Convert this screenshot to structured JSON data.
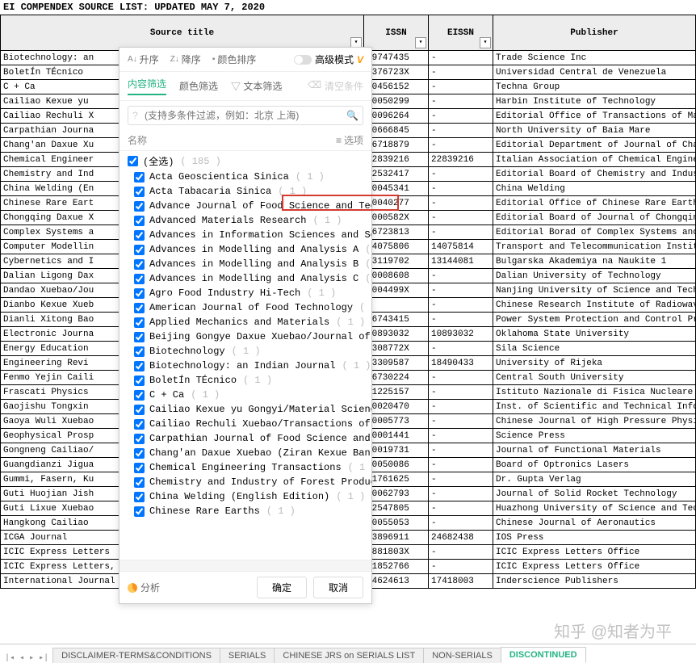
{
  "title": "EI COMPENDEX SOURCE LIST: UPDATED MAY 7, 2020",
  "columns": {
    "source_title": "Source title",
    "issn": "ISSN",
    "eissn": "EISSN",
    "publisher": "Publisher"
  },
  "rows": [
    {
      "title": "Biotechnology: an",
      "issn": "09747435",
      "eissn": "-",
      "pub": "Trade Science Inc"
    },
    {
      "title": "BoletÍn TÉcnico",
      "issn": "0376723X",
      "eissn": "-",
      "pub": "Universidad Central de Venezuela"
    },
    {
      "title": "C + Ca",
      "issn": "00456152",
      "eissn": "-",
      "pub": "Techna Group"
    },
    {
      "title": "Cailiao Kexue yu",
      "issn": "10050299",
      "eissn": "-",
      "pub": "Harbin Institute of Technology"
    },
    {
      "title": "Cailiao Rechuli X",
      "issn": "10096264",
      "eissn": "-",
      "pub": "Editorial Office of Transactions of Materi"
    },
    {
      "title": "Carpathian Journa",
      "issn": "20666845",
      "eissn": "-",
      "pub": "North University of Baia Mare"
    },
    {
      "title": "Chang'an Daxue Xu",
      "issn": "16718879",
      "eissn": "-",
      "pub": "Editorial Department of Journal of Chang'a"
    },
    {
      "title": "Chemical Engineer",
      "issn": "",
      "eissn": "22839216",
      "pub": "Italian Association of Chemical Engineerin"
    },
    {
      "title": "Chemistry and Ind",
      "issn": "02532417",
      "eissn": "-",
      "pub": "Editorial Board of Chemistry and Industry"
    },
    {
      "title": "China Welding (En",
      "issn": "10045341",
      "eissn": "-",
      "pub": "China Welding"
    },
    {
      "title": "Chinese Rare Eart",
      "issn": "10040277",
      "eissn": "-",
      "pub": "Editorial Office of Chinese Rare Earths"
    },
    {
      "title": "Chongqing Daxue X",
      "issn": "1000582X",
      "eissn": "-",
      "pub": "Editorial Board of Journal of Chongqing Un"
    },
    {
      "title": "Complex Systems a",
      "issn": "16723813",
      "eissn": "-",
      "pub": "Editorial Borad of Complex Systems and Com"
    },
    {
      "title": "Computer Modellin",
      "issn": "14075806",
      "eissn": "14075814",
      "pub": "Transport and Telecommunication Institute"
    },
    {
      "title": "Cybernetics and I",
      "issn": "13119702",
      "eissn": "13144081",
      "pub": "Bulgarska Akademiya na Naukite 1"
    },
    {
      "title": "Dalian Ligong Dax",
      "issn": "10008608",
      "eissn": "-",
      "pub": "Dalian University of Technology"
    },
    {
      "title": "Dandao Xuebao/Jou",
      "issn": "1004499X",
      "eissn": "-",
      "pub": "Nanjing University of Science and Technolo"
    },
    {
      "title": "Dianbo Kexue Xueb",
      "issn": "",
      "eissn": "-",
      "pub": "Chinese Research Institute of Radiowave Pr"
    },
    {
      "title": "Dianli Xitong Bao",
      "issn": "16743415",
      "eissn": "-",
      "pub": "Power System Protection and Control Press"
    },
    {
      "title": "Electronic Journa",
      "issn": "",
      "eissn": "10893032",
      "pub": "Oklahoma State University"
    },
    {
      "title": "Energy Education",
      "issn": "1308772X",
      "eissn": "-",
      "pub": "Sila Science"
    },
    {
      "title": "Engineering Revi",
      "issn": "13309587",
      "eissn": "18490433",
      "pub": "University of Rijeka"
    },
    {
      "title": "Fenmo Yejin Caili",
      "issn": "16730224",
      "eissn": "-",
      "pub": "Central South University"
    },
    {
      "title": "Frascati Physics",
      "issn": "11225157",
      "eissn": "-",
      "pub": "Istituto Nazionale di Fisica Nucleare"
    },
    {
      "title": "Gaojishu Tongxin",
      "issn": "10020470",
      "eissn": "-",
      "pub": "Inst. of Scientific and Technical Informat"
    },
    {
      "title": "Gaoya Wuli Xuebao",
      "issn": "10005773",
      "eissn": "-",
      "pub": "Chinese Journal of High Pressure Physics"
    },
    {
      "title": "Geophysical Prosp",
      "issn": "10001441",
      "eissn": "-",
      "pub": "Science Press"
    },
    {
      "title": "Gongneng Cailiao/",
      "issn": "10019731",
      "eissn": "-",
      "pub": "Journal of Functional Materials"
    },
    {
      "title": "Guangdianzi Jigua",
      "issn": "10050086",
      "eissn": "-",
      "pub": "Board of Optronics Lasers"
    },
    {
      "title": "Gummi, Fasern, Ku",
      "issn": "01761625",
      "eissn": "-",
      "pub": "Dr. Gupta Verlag"
    },
    {
      "title": "Guti Huojian Jish",
      "issn": "10062793",
      "eissn": "-",
      "pub": "Journal of Solid Rocket Technology"
    },
    {
      "title": "Guti Lixue Xuebao",
      "issn": "02547805",
      "eissn": "-",
      "pub": "Huazhong University of Science and Technol"
    },
    {
      "title": "Hangkong Cailiao",
      "issn": "10055053",
      "eissn": "-",
      "pub": "Chinese Journal of Aeronautics"
    },
    {
      "title": "ICGA Journal",
      "issn": "",
      "eissn": "13896911",
      "eissn2": "24682438",
      "pub": "IOS Press"
    },
    {
      "title": "ICIC Express Letters",
      "issn": "",
      "eissn": "1881803X",
      "eissn2": "-",
      "pub": "ICIC Express Letters Office"
    },
    {
      "title": "ICIC Express Letters, Part B: Applications",
      "issn": "",
      "eissn": "21852766",
      "eissn2": "-",
      "pub": "ICIC Express Letters Office"
    },
    {
      "title": "International Journal of Advanced Media and Communication",
      "issn": "",
      "eissn": "14624613",
      "eissn2": "17418003",
      "pub": "Inderscience Publishers"
    }
  ],
  "filter_panel": {
    "sort_asc": "升序",
    "sort_desc": "降序",
    "sort_color": "颜色排序",
    "adv_mode": "高级模式",
    "tab_content": "内容筛选",
    "tab_color": "颜色筛选",
    "text_filter": "文本筛选",
    "clear": "清空条件",
    "search_placeholder": "(支持多条件过滤，例如：北京 上海)",
    "name_col": "名称",
    "options": "选项",
    "select_all_label": "(全选)",
    "select_all_count": "( 185 )",
    "analyze": "分析",
    "ok": "确定",
    "cancel": "取消",
    "items": [
      {
        "label": "Acta Geoscientica Sinica",
        "cnt": "( 1 )"
      },
      {
        "label": "Acta Tabacaria Sinica",
        "cnt": "( 1 )"
      },
      {
        "label": "Advance Journal of Food Science and Technolo",
        "cnt": ""
      },
      {
        "label": "Advanced Materials Research",
        "cnt": "( 1 )"
      },
      {
        "label": "Advances in Information Sciences and Service",
        "cnt": ""
      },
      {
        "label": "Advances in Modelling and Analysis A",
        "cnt": "( 1 )"
      },
      {
        "label": "Advances in Modelling and Analysis B",
        "cnt": "( 1 )"
      },
      {
        "label": "Advances in Modelling and Analysis C",
        "cnt": "( 1 )"
      },
      {
        "label": "Agro Food Industry Hi-Tech",
        "cnt": "( 1 )"
      },
      {
        "label": "American Journal of Food Technology",
        "cnt": "( 1 )"
      },
      {
        "label": "Applied Mechanics and Materials",
        "cnt": "( 1 )"
      },
      {
        "label": "Beijing Gongye Daxue Xuebao/Journal of Beiji",
        "cnt": ""
      },
      {
        "label": "Biotechnology",
        "cnt": "( 1 )"
      },
      {
        "label": "Biotechnology: an Indian Journal",
        "cnt": "( 1 )"
      },
      {
        "label": "BoletÍn TÉcnico",
        "cnt": "( 1 )"
      },
      {
        "label": "C + Ca",
        "cnt": "( 1 )"
      },
      {
        "label": "Cailiao Kexue yu Gongyi/Material Science and",
        "cnt": ""
      },
      {
        "label": "Cailiao Rechuli Xuebao/Transactions of Mater",
        "cnt": ""
      },
      {
        "label": "Carpathian Journal of Food Science and Techn",
        "cnt": ""
      },
      {
        "label": "Chang'an Daxue Xuebao (Ziran Kexue Ban)/Jour",
        "cnt": ""
      },
      {
        "label": "Chemical Engineering Transactions",
        "cnt": "( 1 )"
      },
      {
        "label": "Chemistry and Industry of Forest Products",
        "cnt": "( 1 )"
      },
      {
        "label": "China Welding (English Edition)",
        "cnt": "( 1 )"
      },
      {
        "label": "Chinese Rare Earths",
        "cnt": "( 1 )"
      }
    ]
  },
  "sheet_tabs": {
    "t1": "DISCLAIMER-TERMS&CONDITIONS",
    "t2": "SERIALS",
    "t3": "CHINESE JRS on SERIALS LIST",
    "t4": "NON-SERIALS",
    "t5": "DISCONTINUED"
  },
  "watermark": "知乎 @知者为平"
}
